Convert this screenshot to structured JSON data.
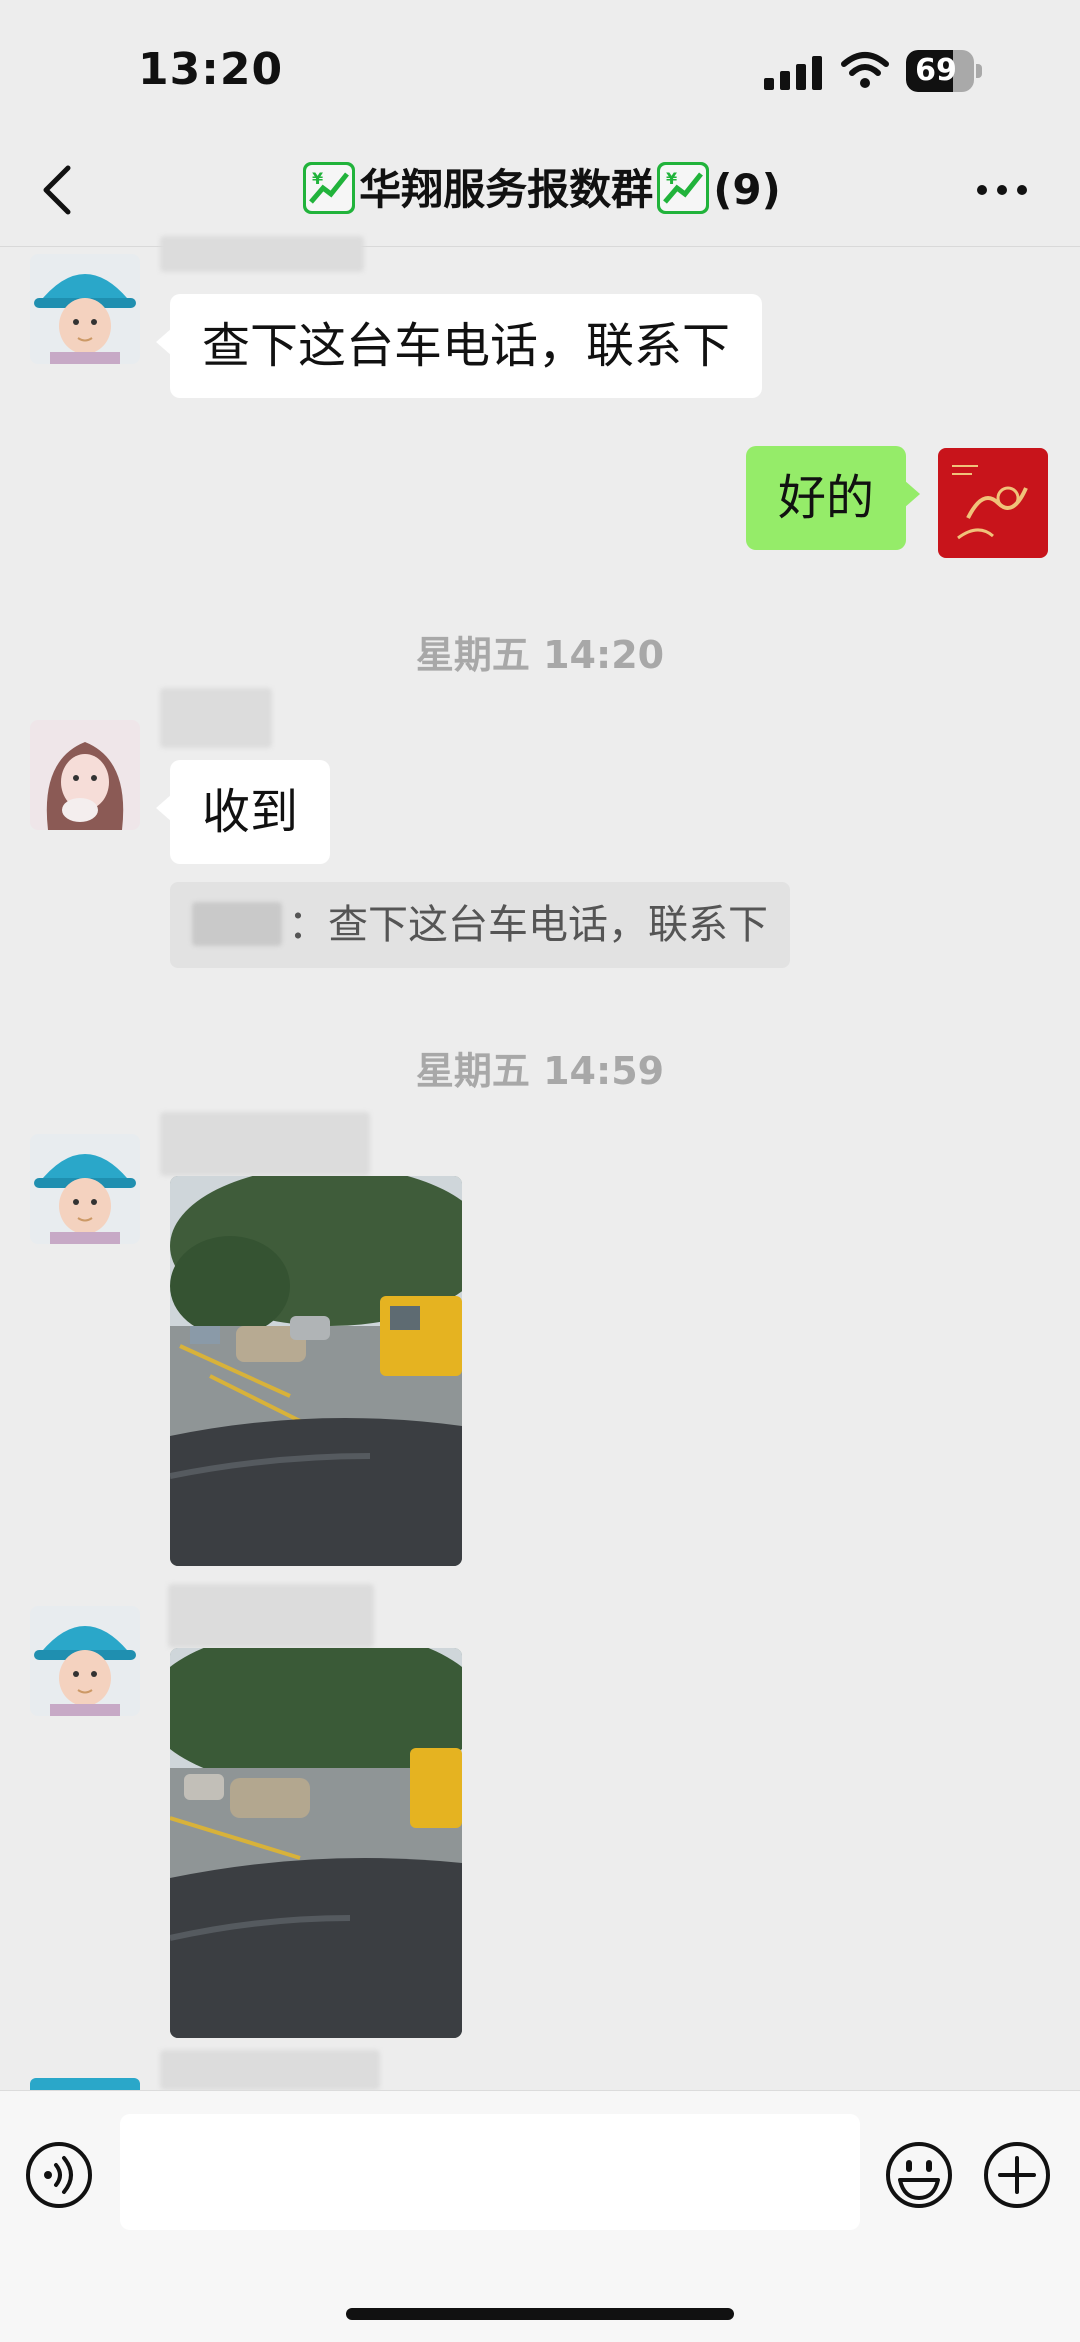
{
  "status_bar": {
    "time": "13:20",
    "battery": "69",
    "battery_level": 0.69
  },
  "nav": {
    "title_main": "华翔服务报数群",
    "title_count": "(9)"
  },
  "messages": {
    "m1_text": "查下这台车电话，联系下",
    "m2_text": "好的",
    "ts1": "星期五 14:20",
    "m3_text": "收到",
    "m3_quote": "：查下这台车电话，联系下",
    "ts2": "星期五 14:59"
  },
  "colors": {
    "my_bubble": "#95ec69",
    "background": "#ededed"
  },
  "icons": [
    "back-icon",
    "more-icon",
    "voice-icon",
    "emoji-icon",
    "plus-icon"
  ]
}
